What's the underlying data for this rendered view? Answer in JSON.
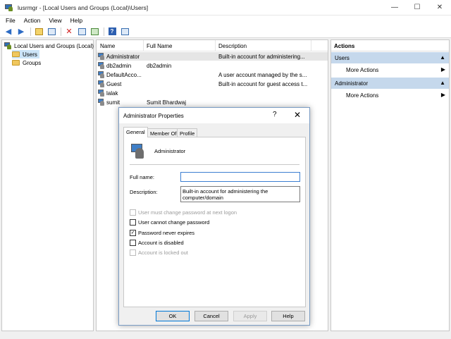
{
  "window": {
    "title": "lusrmgr - [Local Users and Groups (Local)\\Users]",
    "minimize": "—",
    "maximize": "☐",
    "close": "✕"
  },
  "menu": [
    "File",
    "Action",
    "View",
    "Help"
  ],
  "tree": {
    "root": "Local Users and Groups (Local)",
    "users": "Users",
    "groups": "Groups"
  },
  "list": {
    "headers": {
      "name": "Name",
      "full_name": "Full Name",
      "description": "Description"
    },
    "rows": [
      {
        "name": "Administrator",
        "full_name": "",
        "description": "Built-in account for administering..."
      },
      {
        "name": "db2admin",
        "full_name": "db2admin",
        "description": ""
      },
      {
        "name": "DefaultAcco...",
        "full_name": "",
        "description": "A user account managed by the s..."
      },
      {
        "name": "Guest",
        "full_name": "",
        "description": "Built-in account for guest access t..."
      },
      {
        "name": "lalak",
        "full_name": "",
        "description": ""
      },
      {
        "name": "sumit",
        "full_name": "Sumit Bhardwaj",
        "description": ""
      }
    ]
  },
  "actions": {
    "title": "Actions",
    "section1": "Users",
    "section1_item": "More Actions",
    "section2": "Administrator",
    "section2_item": "More Actions"
  },
  "dialog": {
    "title": "Administrator Properties",
    "help_glyph": "?",
    "close_glyph": "✕",
    "tabs": [
      "General",
      "Member Of",
      "Profile"
    ],
    "username": "Administrator",
    "full_name_label": "Full name:",
    "full_name_value": "",
    "description_label": "Description:",
    "description_value": "Built-in account for administering the computer/domain",
    "checkboxes": [
      {
        "label": "User must change password at next logon",
        "checked": false,
        "disabled": true
      },
      {
        "label": "User cannot change password",
        "checked": false,
        "disabled": false
      },
      {
        "label": "Password never expires",
        "checked": true,
        "disabled": false
      },
      {
        "label": "Account is disabled",
        "checked": false,
        "disabled": false
      },
      {
        "label": "Account is locked out",
        "checked": false,
        "disabled": true
      }
    ],
    "buttons": {
      "ok": "OK",
      "cancel": "Cancel",
      "apply": "Apply",
      "help": "Help"
    }
  }
}
